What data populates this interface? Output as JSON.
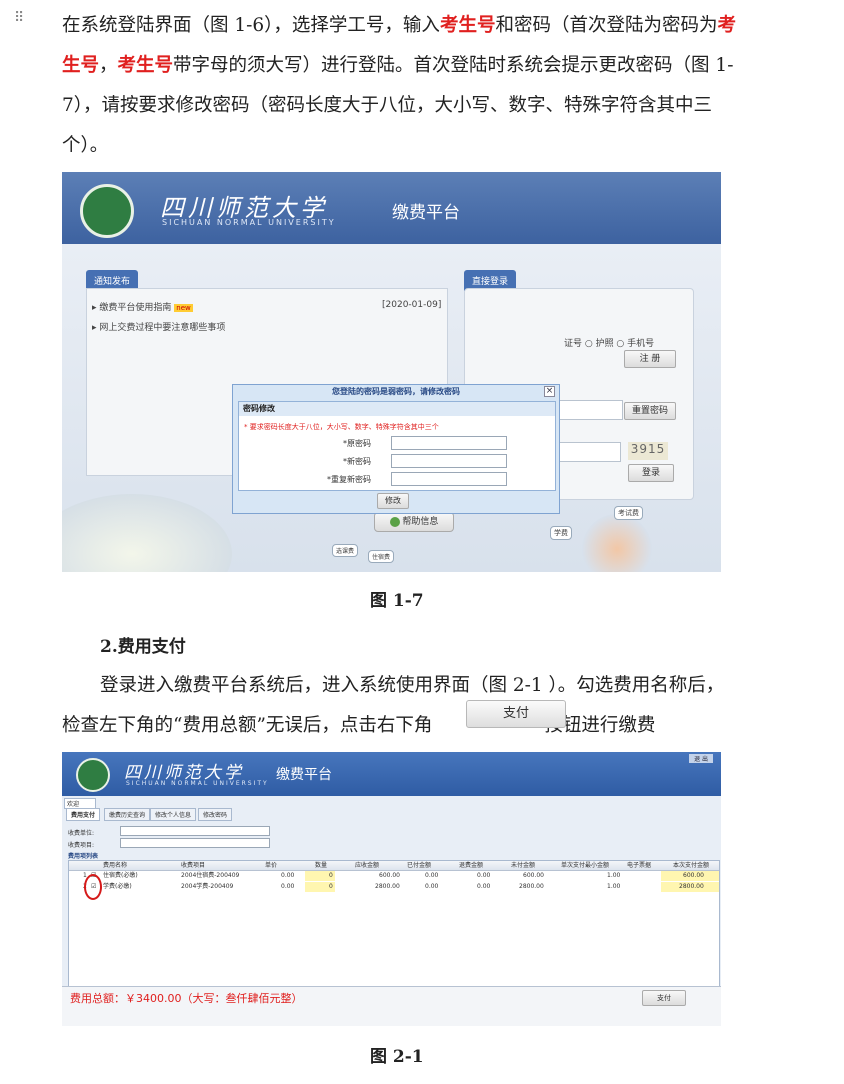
{
  "drag_handle": "⠿",
  "para1": {
    "t1": "在系统登陆界面（图 1-6），选择学工号，输入",
    "r1": "考生号",
    "t2": "和密码（首次登陆为密码为",
    "r2": "考生号",
    "t3": "，",
    "r3": "考生号",
    "t4": "带字母的须大写）进行登陆。首次登陆时系统会提示更改密码（图 1-7），请按要求修改密码（密码长度大于八位，大小写、数字、特殊字符含其中三个）。"
  },
  "fig1": {
    "caption": "图 1-7",
    "brand": "四川师范大学",
    "brand_en": "SICHUAN NORMAL UNIVERSITY",
    "platform": "缴费平台",
    "notice_tab": "通知发布",
    "login_tab": "直接登录",
    "notice1": "缴费平台使用指南",
    "notice1_badge": "new",
    "notice1_date": "[2020-01-09]",
    "notice2": "网上交费过程中要注意哪些事项",
    "id_opts": "证号 ○ 护照 ○ 手机号",
    "register": "注 册",
    "reset_pwd": "重置密码",
    "captcha_value": "3915",
    "captcha_img": "3915",
    "login_btn": "登录",
    "help": "帮助信息",
    "bubble1": "考试费",
    "bubble2": "学费",
    "bubble3": "选课费",
    "bubble4": "住宿费",
    "dialog": {
      "title": "您登陆的密码是弱密码，请修改密码",
      "close": "×",
      "section": "密码修改",
      "rule": "* 要求密码长度大于八位，大小写、数字、特殊字符含其中三个",
      "old": "*原密码",
      "new": "*新密码",
      "repeat": "*重复新密码",
      "submit": "修改"
    }
  },
  "h2": "2.费用支付",
  "para2": {
    "t1": "登录进入缴费平台系统后，进入系统使用界面（图 2-1 ）。勾选费用名称后，检查左下角的“费用总额”无误后，点击右下角",
    "pay_button": "支付",
    "t2": "按钮进行缴费"
  },
  "fig2": {
    "caption": "图 2-1",
    "brand": "四川师范大学",
    "brand_en": "SICHUAN NORMAL UNIVERSITY",
    "platform": "缴费平台",
    "exit": "退 出",
    "welcome": "欢迎",
    "tabs": [
      "费用支付",
      "缴费历史查询",
      "修改个人信息",
      "修改密码"
    ],
    "fee_unit_label": "收费单位:",
    "fee_item_label": "收费项目:",
    "list_title": "费用项列表",
    "columns": [
      "费用名称",
      "收费项目",
      "单价",
      "数量",
      "应收金额",
      "已付金额",
      "退费金额",
      "未付金额",
      "单次支付最小金额",
      "电子票据",
      "本次支付金额"
    ],
    "rows": [
      {
        "no": "1",
        "name": "住宿费(必缴)",
        "item": "2004住宿费-200409",
        "price": "0.00",
        "qty": "0",
        "due": "600.00",
        "paid": "0.00",
        "refund": "0.00",
        "unpaid": "600.00",
        "min": "1.00",
        "pay": "600.00"
      },
      {
        "no": "2",
        "name": "学费(必缴)",
        "item": "2004学费-200409",
        "price": "0.00",
        "qty": "0",
        "due": "2800.00",
        "paid": "0.00",
        "refund": "0.00",
        "unpaid": "2800.00",
        "min": "1.00",
        "pay": "2800.00"
      }
    ],
    "total": "费用总额：￥3400.00（大写：叁仟肆佰元整）",
    "pay_btn": "支付"
  },
  "colors": {
    "emphasis": "#e0201f",
    "header_blue": "#3d62a0",
    "highlight": "#fff6b0"
  }
}
